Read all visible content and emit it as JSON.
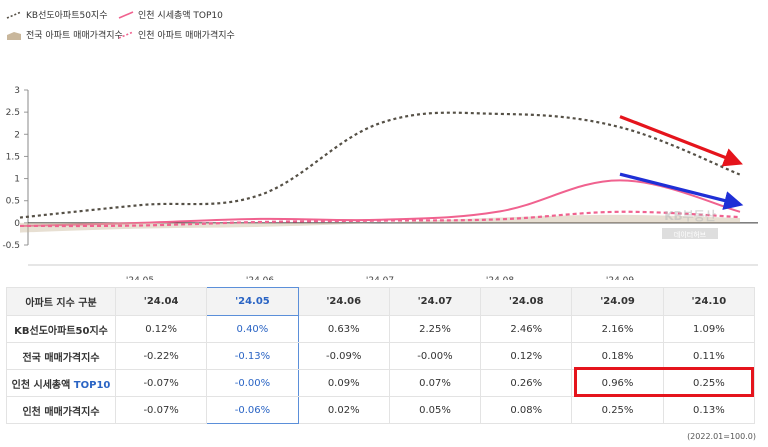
{
  "legend": [
    {
      "label": "KB선도아파트50지수",
      "color": "#555046",
      "style": "dotted-line"
    },
    {
      "label": "인천 시세총액 TOP10",
      "color": "#f0628f",
      "style": "solid-line"
    },
    {
      "label": "전국 아파트 매매가격지수",
      "color": "#c9b79c",
      "style": "area"
    },
    {
      "label": "인천 아파트 매매가격지수",
      "color": "#f0628f",
      "style": "dotted-line"
    }
  ],
  "chart_data": {
    "type": "line",
    "x": [
      "'24.04",
      "'24.05",
      "'24.06",
      "'24.07",
      "'24.08",
      "'24.09",
      "'24.10"
    ],
    "x_tick_labels": [
      "'24.05",
      "'24.06",
      "'24.07",
      "'24.08",
      "'24.09"
    ],
    "y_ticks": [
      "3",
      "2.5",
      "2",
      "1.5",
      "1",
      "0.5",
      "0",
      "-0.5"
    ],
    "ylim": [
      -0.5,
      3
    ],
    "series": [
      {
        "name": "KB선도아파트50지수",
        "color": "#555046",
        "dash": "3,3",
        "values": [
          0.12,
          0.4,
          0.63,
          2.25,
          2.46,
          2.16,
          1.09
        ]
      },
      {
        "name": "인천 시세총액 TOP10",
        "color": "#f0628f",
        "dash": "",
        "values": [
          -0.07,
          -0.0,
          0.09,
          0.07,
          0.26,
          0.96,
          0.25
        ]
      },
      {
        "name": "전국 아파트 매매가격지수",
        "color": "#c9b79c",
        "dash": "",
        "area": true,
        "values": [
          -0.22,
          -0.13,
          -0.09,
          -0.0,
          0.12,
          0.18,
          0.11
        ]
      },
      {
        "name": "인천 아파트 매매가격지수",
        "color": "#f0628f",
        "dash": "4,3",
        "values": [
          -0.07,
          -0.06,
          0.02,
          0.05,
          0.08,
          0.25,
          0.13
        ]
      }
    ],
    "watermark": "KB부동산",
    "watermark_sub": "데이터허브",
    "arrows": [
      {
        "color": "#e5141c",
        "from": [
          "'24.09",
          2.4
        ],
        "to": [
          "'24.10",
          1.4
        ]
      },
      {
        "color": "#1f2fd6",
        "from": [
          "'24.09",
          1.1
        ],
        "to": [
          "'24.10",
          0.45
        ]
      }
    ]
  },
  "table": {
    "header_label": "아파트 지수 구분",
    "columns": [
      "'24.04",
      "'24.05",
      "'24.06",
      "'24.07",
      "'24.08",
      "'24.09",
      "'24.10"
    ],
    "highlight_column": 1,
    "rows": [
      {
        "label": "KB선도아파트50지수",
        "label_suffix": "",
        "values": [
          "0.12%",
          "0.40%",
          "0.63%",
          "2.25%",
          "2.46%",
          "2.16%",
          "1.09%"
        ]
      },
      {
        "label": "전국 매매가격지수",
        "label_suffix": "",
        "values": [
          "-0.22%",
          "-0.13%",
          "-0.09%",
          "-0.00%",
          "0.12%",
          "0.18%",
          "0.11%"
        ]
      },
      {
        "label": "인천 시세총액 ",
        "label_suffix": "TOP10",
        "values": [
          "-0.07%",
          "-0.00%",
          "0.09%",
          "0.07%",
          "0.26%",
          "0.96%",
          "0.25%"
        ]
      },
      {
        "label": "인천 매매가격지수",
        "label_suffix": "",
        "values": [
          "-0.07%",
          "-0.06%",
          "0.02%",
          "0.05%",
          "0.08%",
          "0.25%",
          "0.13%"
        ]
      }
    ]
  },
  "footnote": "(2022.01=100.0)"
}
